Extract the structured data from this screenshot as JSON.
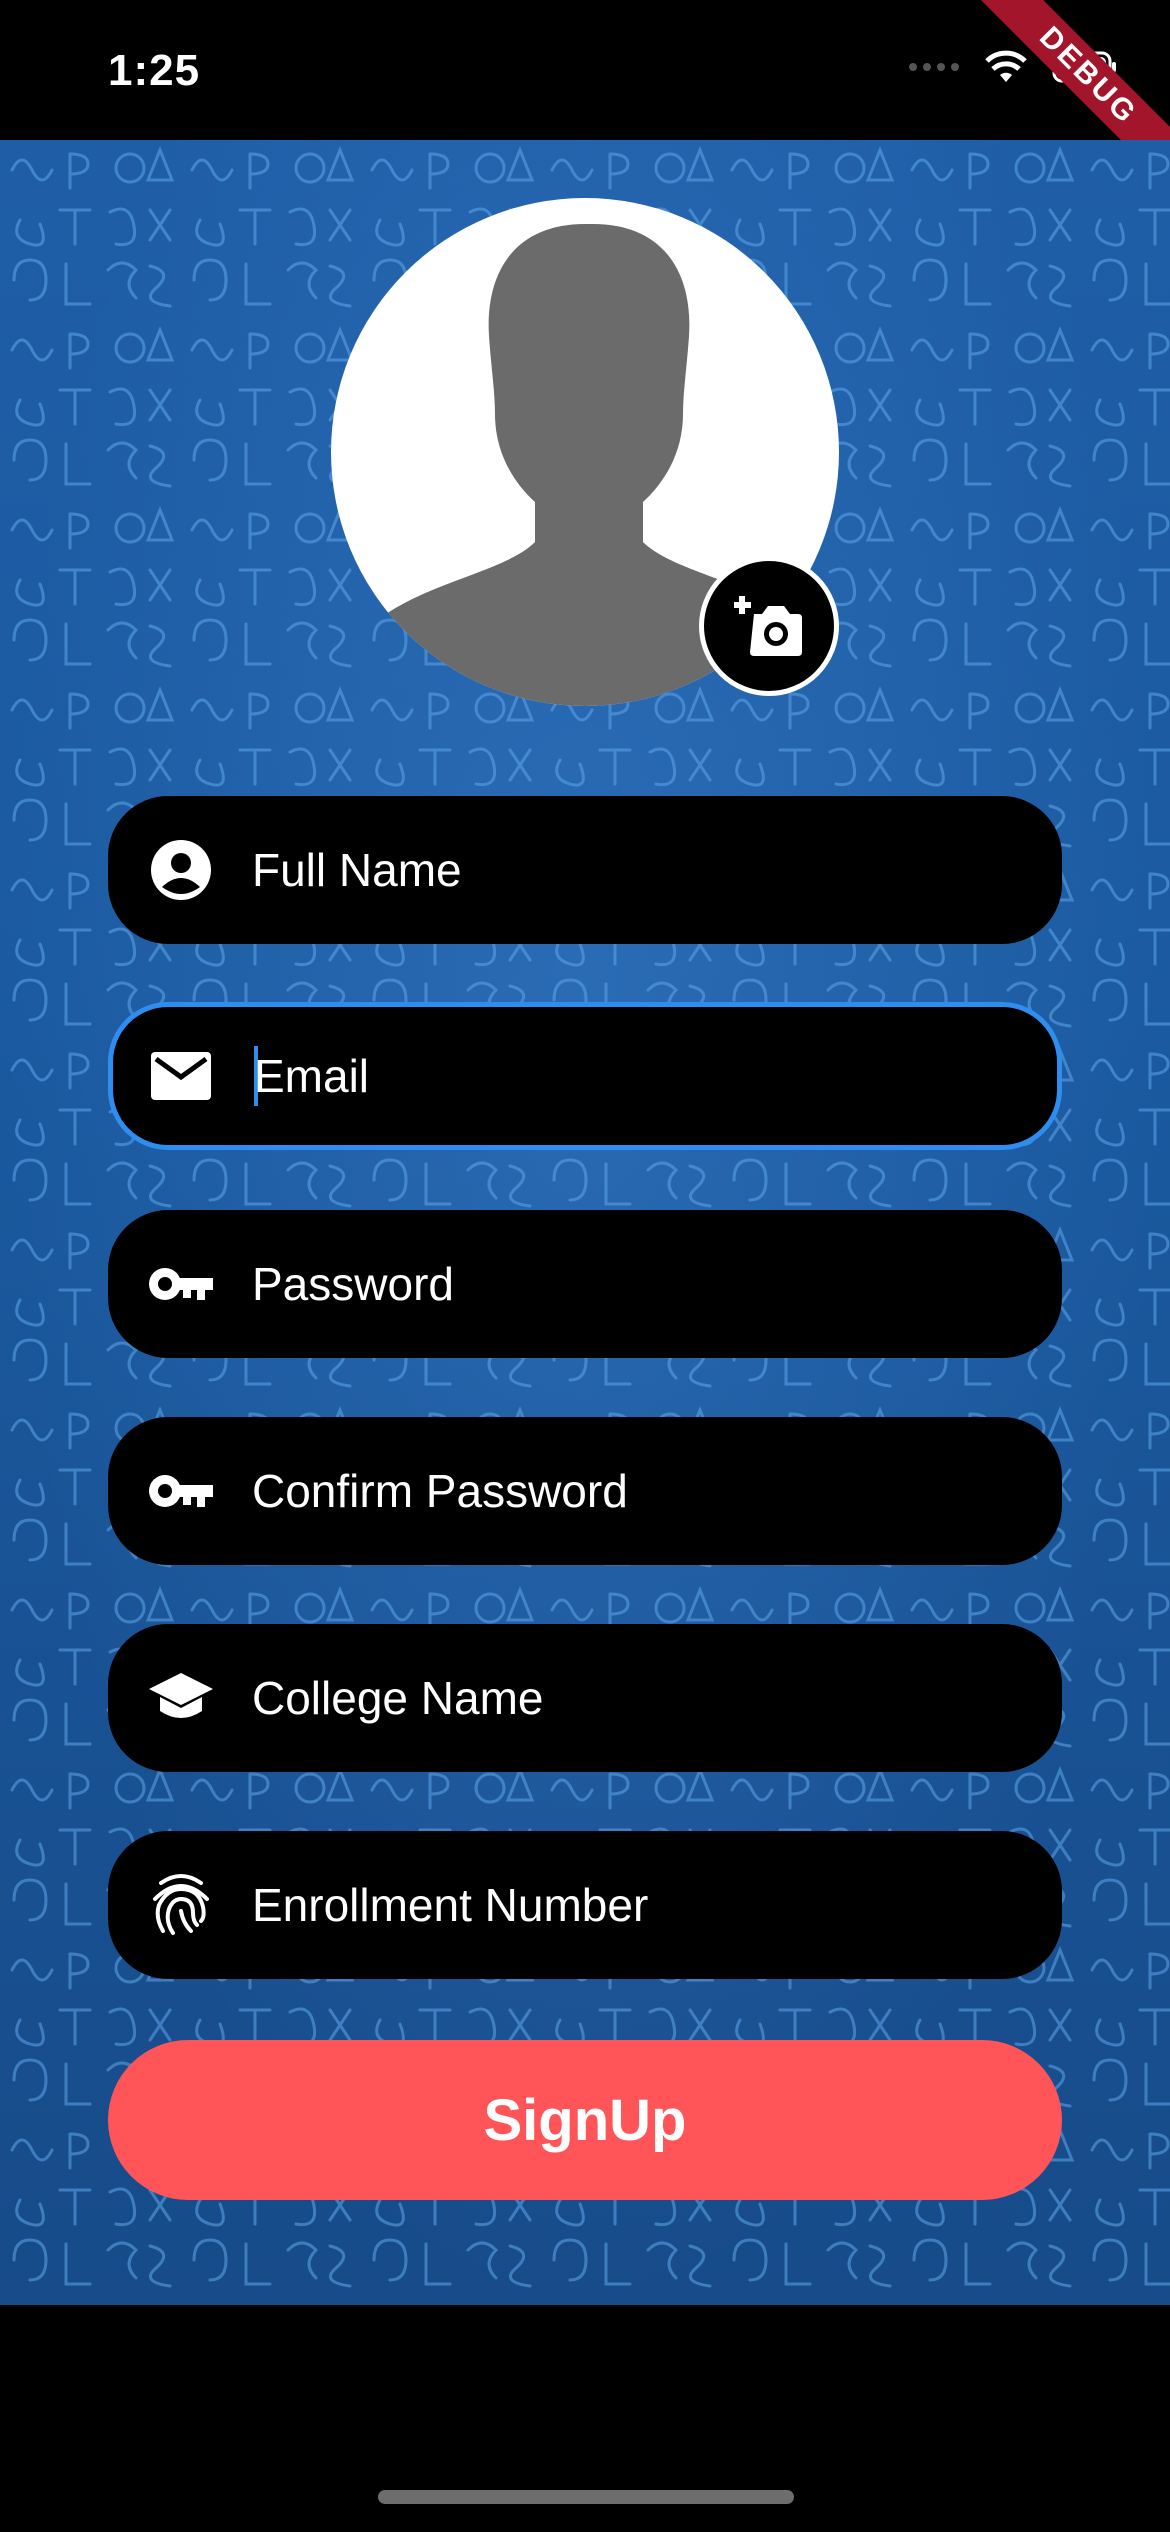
{
  "status_bar": {
    "time": "1:25",
    "debug_label": "DEBUG"
  },
  "form": {
    "fields": [
      {
        "placeholder": "Full Name",
        "icon": "account-circle-icon"
      },
      {
        "placeholder": "Email",
        "icon": "mail-icon",
        "focused": true
      },
      {
        "placeholder": "Password",
        "icon": "key-icon"
      },
      {
        "placeholder": "Confirm Password",
        "icon": "key-icon"
      },
      {
        "placeholder": "College Name",
        "icon": "graduation-cap-icon"
      },
      {
        "placeholder": "Enrollment Number",
        "icon": "fingerprint-icon"
      }
    ],
    "submit_label": "SignUp"
  },
  "colors": {
    "accent": "#ff5558",
    "focus": "#2e8ef0",
    "background": "#1b5aa0"
  }
}
